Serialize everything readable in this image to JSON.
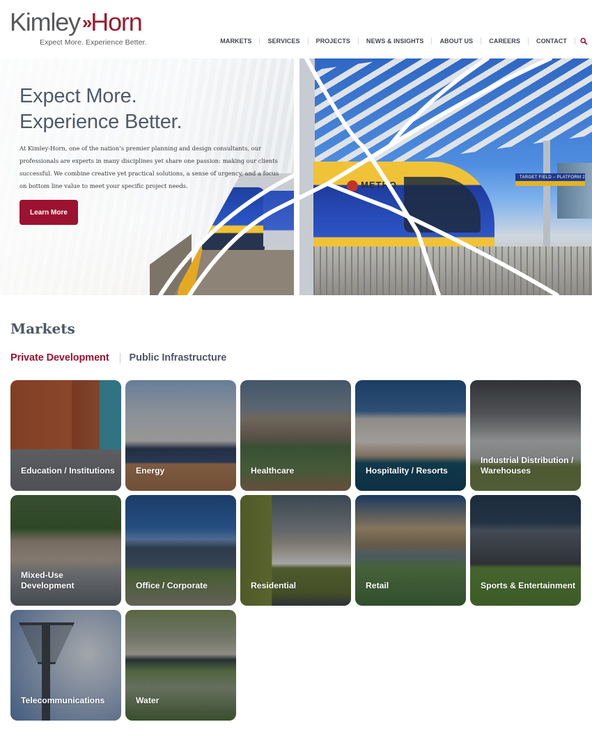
{
  "brand": {
    "name_left": "Kimley",
    "chevrons": "»",
    "name_right": "Horn",
    "tagline": "Expect More. Experience Better.",
    "accent_color": "#9b1330"
  },
  "nav": {
    "items": [
      {
        "label": "MARKETS"
      },
      {
        "label": "SERVICES"
      },
      {
        "label": "PROJECTS"
      },
      {
        "label": "NEWS & INSIGHTS"
      },
      {
        "label": "ABOUT US"
      },
      {
        "label": "CAREERS"
      },
      {
        "label": "CONTACT"
      }
    ],
    "search_icon": "search-icon"
  },
  "hero": {
    "title_line1": "Expect More.",
    "title_line2": "Experience Better.",
    "body": "At Kimley-Horn, one of the nation’s premier planning and design consultants, our professionals are experts in many disciplines yet share one passion: making our clients successful. We combine creative yet practical solutions, a sense of urgency, and a focus on bottom line value to meet your specific project needs.",
    "cta_label": "Learn More",
    "image_metro_text": "METRO",
    "image_sign_text": "TARGET FIELD – PLATFORM 2"
  },
  "markets": {
    "title": "Markets",
    "tabs": [
      {
        "label": "Private Development",
        "active": true
      },
      {
        "label": "Public Infrastructure",
        "active": false
      }
    ],
    "cards": [
      {
        "label": "Education / Institutions",
        "key": "education"
      },
      {
        "label": "Energy",
        "key": "energy"
      },
      {
        "label": "Healthcare",
        "key": "healthcare"
      },
      {
        "label": "Hospitality / Resorts",
        "key": "hospitality"
      },
      {
        "label": "Industrial Distribution / Warehouses",
        "key": "industrial"
      },
      {
        "label": "Mixed-Use Development",
        "key": "mixed"
      },
      {
        "label": "Office / Corporate",
        "key": "office"
      },
      {
        "label": "Residential",
        "key": "residential"
      },
      {
        "label": "Retail",
        "key": "retail"
      },
      {
        "label": "Sports & Entertainment",
        "key": "sports"
      },
      {
        "label": "Telecommunications",
        "key": "telecom"
      },
      {
        "label": "Water",
        "key": "water"
      }
    ]
  }
}
